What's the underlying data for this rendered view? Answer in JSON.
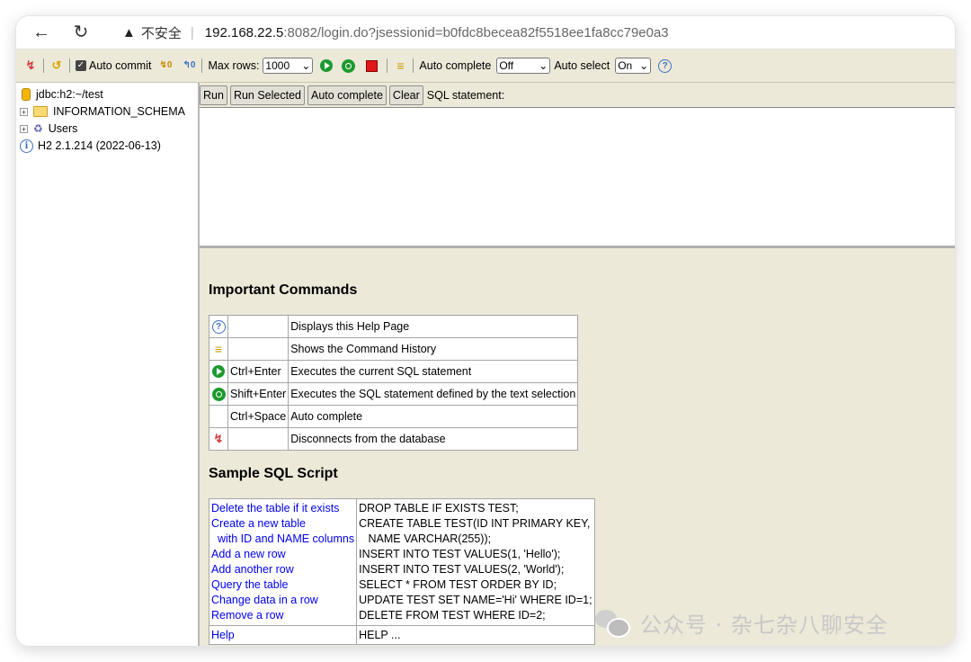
{
  "browser": {
    "insecure_label": "不安全",
    "url_host": "192.168.22.5",
    "url_rest": ":8082/login.do?jsessionid=b0fdc8becea82f5518ee1fa8cc79e0a3"
  },
  "toolbar": {
    "auto_commit_label": "Auto commit",
    "auto_commit_checked": true,
    "max_rows_label": "Max rows:",
    "max_rows_value": "1000",
    "auto_complete_label": "Auto complete",
    "auto_complete_value": "Off",
    "auto_select_label": "Auto select",
    "auto_select_value": "On"
  },
  "tree": {
    "connection": "jdbc:h2:~/test",
    "items": [
      {
        "label": "INFORMATION_SCHEMA",
        "icon": "folder-icon"
      },
      {
        "label": "Users",
        "icon": "users-icon"
      }
    ],
    "version": "H2 2.1.214 (2022-06-13)"
  },
  "query": {
    "run_label": "Run",
    "run_selected_label": "Run Selected",
    "auto_complete_label": "Auto complete",
    "clear_label": "Clear",
    "sql_statement_label": "SQL statement:"
  },
  "important": {
    "title": "Important Commands",
    "rows": [
      {
        "icon": "help-icon",
        "shortcut": "",
        "description": "Displays this Help Page"
      },
      {
        "icon": "history-icon",
        "shortcut": "",
        "description": "Shows the Command History"
      },
      {
        "icon": "run-icon",
        "shortcut": "Ctrl+Enter",
        "description": "Executes the current SQL statement"
      },
      {
        "icon": "run-selected-icon",
        "shortcut": "Shift+Enter",
        "description": "Executes the SQL statement defined by the text selection"
      },
      {
        "icon": "",
        "shortcut": "Ctrl+Space",
        "description": "Auto complete"
      },
      {
        "icon": "disconnect-icon",
        "shortcut": "",
        "description": "Disconnects from the database"
      }
    ]
  },
  "sample": {
    "title": "Sample SQL Script",
    "left_lines": [
      "Delete the table if it exists",
      "Create a new table",
      "  with ID and NAME columns",
      "Add a new row",
      "Add another row",
      "Query the table",
      "Change data in a row",
      "Remove a row"
    ],
    "right_lines": [
      "DROP TABLE IF EXISTS TEST;",
      "CREATE TABLE TEST(ID INT PRIMARY KEY,",
      "   NAME VARCHAR(255));",
      "INSERT INTO TEST VALUES(1, 'Hello');",
      "INSERT INTO TEST VALUES(2, 'World');",
      "SELECT * FROM TEST ORDER BY ID;",
      "UPDATE TEST SET NAME='Hi' WHERE ID=1;",
      "DELETE FROM TEST WHERE ID=2;"
    ],
    "help_link": "Help",
    "help_code": "HELP ..."
  },
  "watermark": "公众号 · 杂七杂八聊安全"
}
